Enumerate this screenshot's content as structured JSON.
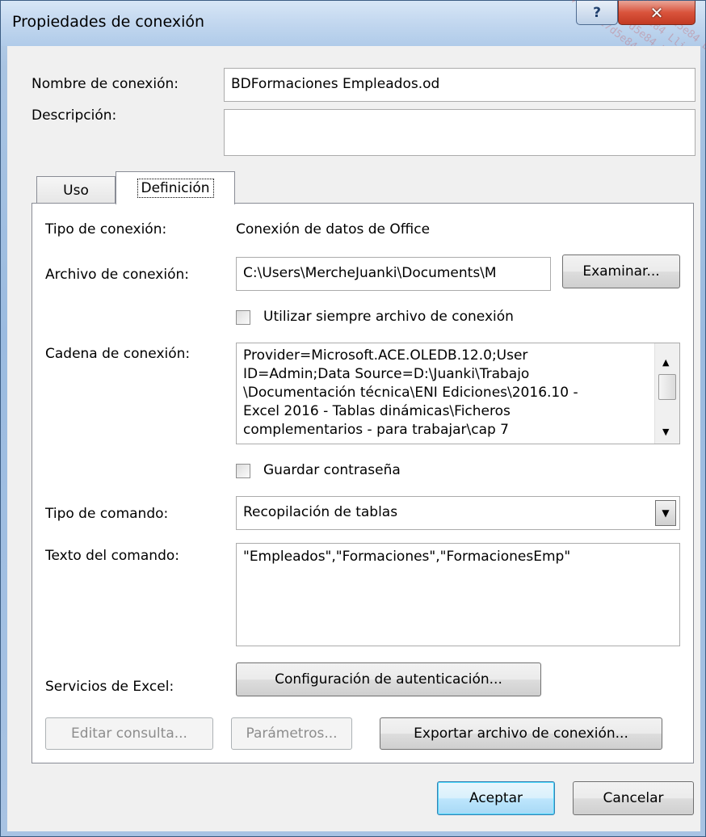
{
  "window": {
    "title": "Propiedades de conexión",
    "help_label": "?",
    "close_label": "✕",
    "watermark_lines": [
      "4-ead6c7d5e84 Lligon",
      "1ead6c7d5e84 Lligon",
      "d6c7d5e84 Lligon",
      "ead6c7d5e84 Lligon"
    ]
  },
  "connection_name": {
    "label": "Nombre de conexión:",
    "value": "BDFormaciones Empleados.od"
  },
  "description": {
    "label": "Descripción:",
    "value": ""
  },
  "tabs": [
    {
      "label": "Uso"
    },
    {
      "label": "Definición"
    }
  ],
  "definition": {
    "type_label": "Tipo de conexión:",
    "type_value": "Conexión de datos de Office",
    "file_label": "Archivo de conexión:",
    "file_value": "C:\\Users\\MercheJuanki\\Documents\\M",
    "browse_button": "Examinar...",
    "always_use_file": "Utilizar siempre archivo de conexión",
    "string_label": "Cadena de conexión:",
    "string_lines": [
      "Provider=Microsoft.ACE.OLEDB.12.0;User",
      "ID=Admin;Data Source=D:\\Juanki\\Trabajo",
      "\\Documentación técnica\\ENI Ediciones\\2016.10 -",
      "Excel 2016 - Tablas dinámicas\\Ficheros",
      "complementarios - para trabajar\\cap 7"
    ],
    "save_password": "Guardar contraseña",
    "command_type_label": "Tipo de comando:",
    "command_type_value": "Recopilación de tablas",
    "command_text_label": "Texto del comando:",
    "command_text_value": "\"Empleados\",\"Formaciones\",\"FormacionesEmp\"",
    "excel_services_label": "Servicios de Excel:",
    "auth_button": "Configuración de autenticación...",
    "edit_query_button": "Editar consulta...",
    "parameters_button": "Parámetros...",
    "export_button": "Exportar archivo de conexión..."
  },
  "footer": {
    "ok_button": "Aceptar",
    "cancel_button": "Cancelar"
  }
}
